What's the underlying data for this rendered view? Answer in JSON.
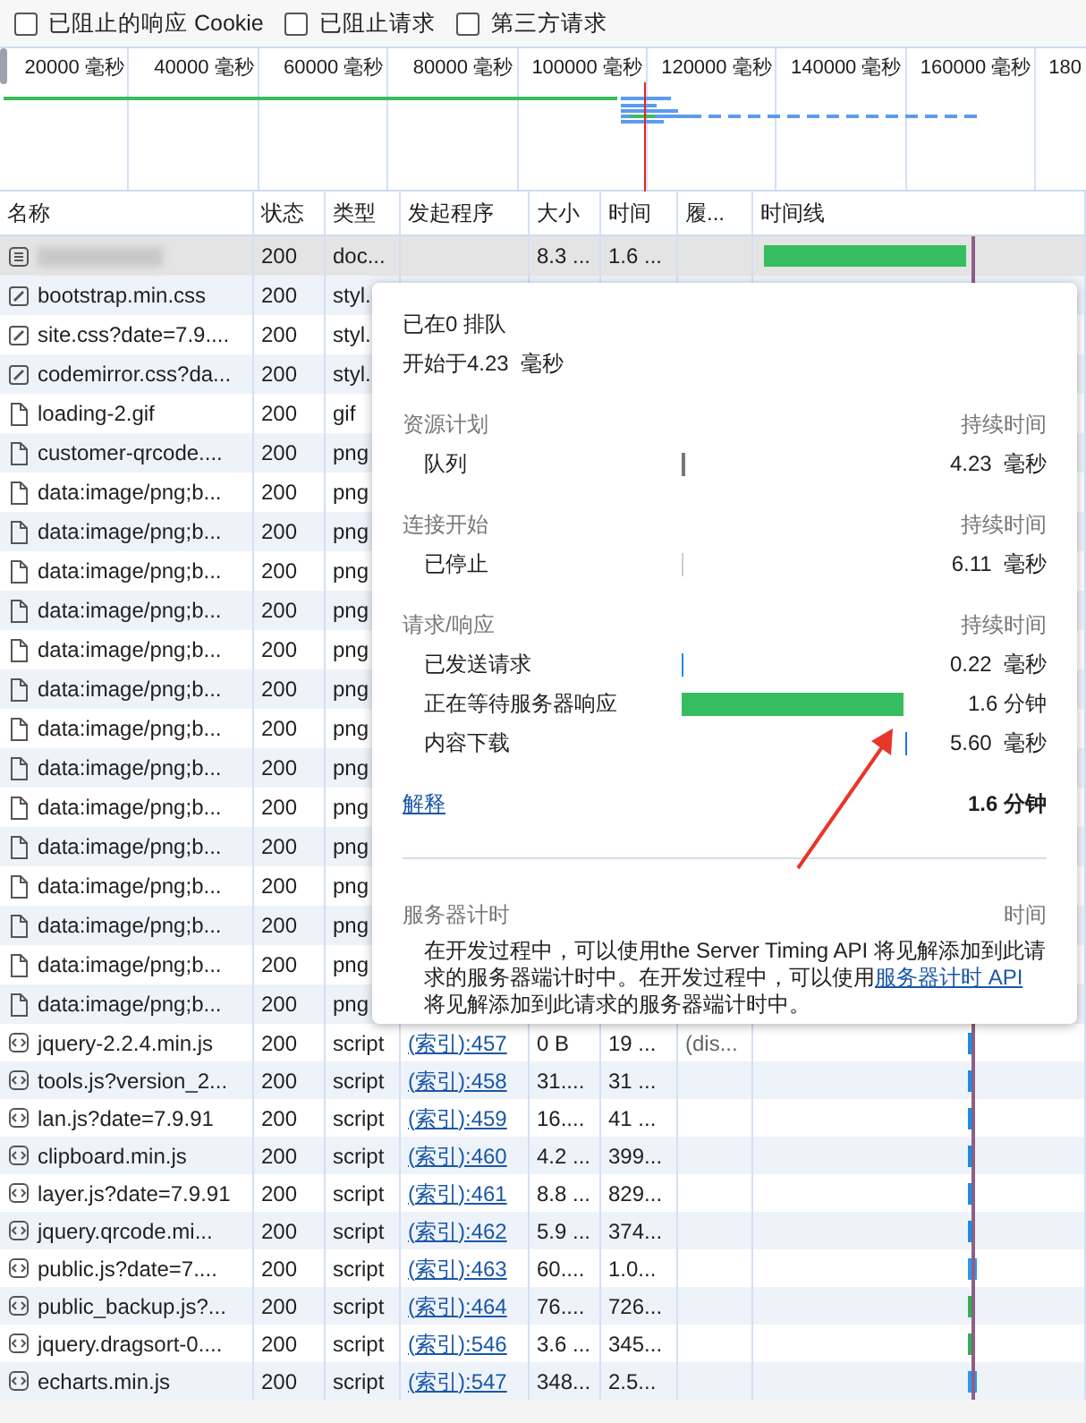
{
  "filters": [
    {
      "label": "已阻止的响应 Cookie",
      "checked": false
    },
    {
      "label": "已阻止请求",
      "checked": false
    },
    {
      "label": "第三方请求",
      "checked": false
    }
  ],
  "overview": {
    "ticks": [
      "20000 毫秒",
      "40000 毫秒",
      "60000 毫秒",
      "80000 毫秒",
      "100000 毫秒",
      "120000 毫秒",
      "140000 毫秒",
      "160000 毫秒",
      "180"
    ]
  },
  "table": {
    "columns": [
      "名称",
      "状态",
      "类型",
      "发起程序",
      "大小",
      "时间",
      "履...",
      "时间线"
    ],
    "rows": [
      {
        "kind": "document",
        "name_redacted": true,
        "status": "200",
        "type": "doc...",
        "size": "8.3 ...",
        "time": "1.6 ...",
        "waterfall": {
          "kind": "wait"
        },
        "highlighted": true
      },
      {
        "kind": "stylesheet",
        "name": "bootstrap.min.css",
        "status": "200",
        "type": "styl.",
        "highlighted": false
      },
      {
        "kind": "stylesheet",
        "name": "site.css?date=7.9....",
        "status": "200",
        "type": "styl.",
        "highlighted": false
      },
      {
        "kind": "stylesheet",
        "name": "codemirror.css?da...",
        "status": "200",
        "type": "styl.",
        "highlighted": false
      },
      {
        "kind": "image",
        "name": "loading-2.gif",
        "status": "200",
        "type": "gif",
        "highlighted": false
      },
      {
        "kind": "image",
        "name": "customer-qrcode....",
        "status": "200",
        "type": "png",
        "highlighted": false
      },
      {
        "kind": "image",
        "name": "data:image/png;b...",
        "status": "200",
        "type": "png",
        "highlighted": false
      },
      {
        "kind": "image",
        "name": "data:image/png;b...",
        "status": "200",
        "type": "png",
        "highlighted": false
      },
      {
        "kind": "image",
        "name": "data:image/png;b...",
        "status": "200",
        "type": "png",
        "highlighted": false
      },
      {
        "kind": "image",
        "name": "data:image/png;b...",
        "status": "200",
        "type": "png",
        "highlighted": false
      },
      {
        "kind": "image",
        "name": "data:image/png;b...",
        "status": "200",
        "type": "png",
        "highlighted": false
      },
      {
        "kind": "image",
        "name": "data:image/png;b...",
        "status": "200",
        "type": "png",
        "highlighted": false
      },
      {
        "kind": "image",
        "name": "data:image/png;b...",
        "status": "200",
        "type": "png",
        "highlighted": false
      },
      {
        "kind": "image",
        "name": "data:image/png;b...",
        "status": "200",
        "type": "png",
        "highlighted": false
      },
      {
        "kind": "image",
        "name": "data:image/png;b...",
        "status": "200",
        "type": "png",
        "highlighted": false
      },
      {
        "kind": "image",
        "name": "data:image/png;b...",
        "status": "200",
        "type": "png",
        "highlighted": false
      },
      {
        "kind": "image",
        "name": "data:image/png;b...",
        "status": "200",
        "type": "png",
        "highlighted": false
      },
      {
        "kind": "image",
        "name": "data:image/png;b...",
        "status": "200",
        "type": "png",
        "highlighted": false
      },
      {
        "kind": "image",
        "name": "data:image/png;b...",
        "status": "200",
        "type": "png",
        "highlighted": false
      },
      {
        "kind": "image",
        "name": "data:image/png;b...",
        "status": "200",
        "type": "png",
        "highlighted": false
      },
      {
        "kind": "script",
        "name": "jquery-2.2.4.min.js",
        "status": "200",
        "type": "script",
        "initiator": "(索引):457",
        "size": "0 B",
        "time": "19 ...",
        "column_7": "(dis...",
        "waterfall": {
          "kind": "tick"
        },
        "highlighted": false
      },
      {
        "kind": "script",
        "name": "tools.js?version_2...",
        "status": "200",
        "type": "script",
        "initiator": "(索引):458",
        "size": "31....",
        "time": "31 ...",
        "waterfall": {
          "kind": "tick"
        },
        "highlighted": false
      },
      {
        "kind": "script",
        "name": "lan.js?date=7.9.91",
        "status": "200",
        "type": "script",
        "initiator": "(索引):459",
        "size": "16....",
        "time": "41 ...",
        "waterfall": {
          "kind": "tick"
        },
        "highlighted": false
      },
      {
        "kind": "script",
        "name": "clipboard.min.js",
        "status": "200",
        "type": "script",
        "initiator": "(索引):460",
        "size": "4.2 ...",
        "time": "399...",
        "waterfall": {
          "kind": "tick"
        },
        "highlighted": false
      },
      {
        "kind": "script",
        "name": "layer.js?date=7.9.91",
        "status": "200",
        "type": "script",
        "initiator": "(索引):461",
        "size": "8.8 ...",
        "time": "829...",
        "waterfall": {
          "kind": "tick"
        },
        "highlighted": false
      },
      {
        "kind": "script",
        "name": "jquery.qrcode.mi...",
        "status": "200",
        "type": "script",
        "initiator": "(索引):462",
        "size": "5.9 ...",
        "time": "374...",
        "waterfall": {
          "kind": "tick"
        },
        "highlighted": false
      },
      {
        "kind": "script",
        "name": "public.js?date=7....",
        "status": "200",
        "type": "script",
        "initiator": "(索引):463",
        "size": "60....",
        "time": "1.0...",
        "waterfall": {
          "kind": "wide"
        },
        "highlighted": false
      },
      {
        "kind": "script",
        "name": "public_backup.js?...",
        "status": "200",
        "type": "script",
        "initiator": "(索引):464",
        "size": "76....",
        "time": "726...",
        "waterfall": {
          "kind": "green"
        },
        "highlighted": false
      },
      {
        "kind": "script",
        "name": "jquery.dragsort-0....",
        "status": "200",
        "type": "script",
        "initiator": "(索引):546",
        "size": "3.6 ...",
        "time": "345...",
        "waterfall": {
          "kind": "green"
        },
        "highlighted": false
      },
      {
        "kind": "script",
        "name": "echarts.min.js",
        "status": "200",
        "type": "script",
        "initiator": "(索引):547",
        "size": "348...",
        "time": "2.5...",
        "waterfall": {
          "kind": "wide"
        },
        "highlighted": false
      }
    ]
  },
  "timing_popup": {
    "queued": "已在0 排队",
    "started": "开始于4.23  毫秒",
    "sections": [
      {
        "title": "资源计划",
        "duration_label": "持续时间",
        "rows": [
          {
            "label": "队列",
            "kind": "start-gray",
            "value": "4.23  毫秒"
          }
        ]
      },
      {
        "title": "连接开始",
        "duration_label": "持续时间",
        "rows": [
          {
            "label": "已停止",
            "kind": "start-faint",
            "value": "6.11  毫秒"
          }
        ]
      },
      {
        "title": "请求/响应",
        "duration_label": "持续时间",
        "rows": [
          {
            "label": "已发送请求",
            "kind": "start-blue",
            "value": "0.22  毫秒"
          },
          {
            "label": "正在等待服务器响应",
            "kind": "fill-green",
            "value": "1.6 分钟"
          },
          {
            "label": "内容下载",
            "kind": "end-blue",
            "value": "5.60  毫秒"
          }
        ]
      }
    ],
    "explain_link": "解释",
    "total": "1.6 分钟",
    "server_timing": {
      "title": "服务器计时",
      "time_label": "时间",
      "text": "在开发过程中，可以使用the Server Timing API 将见解添加到此请求的服务器端计时中。在开发过程中，可以使用",
      "link": "服务器计时 API",
      "text_after": "将见解添加到此请求的服务器端计时中。"
    }
  }
}
